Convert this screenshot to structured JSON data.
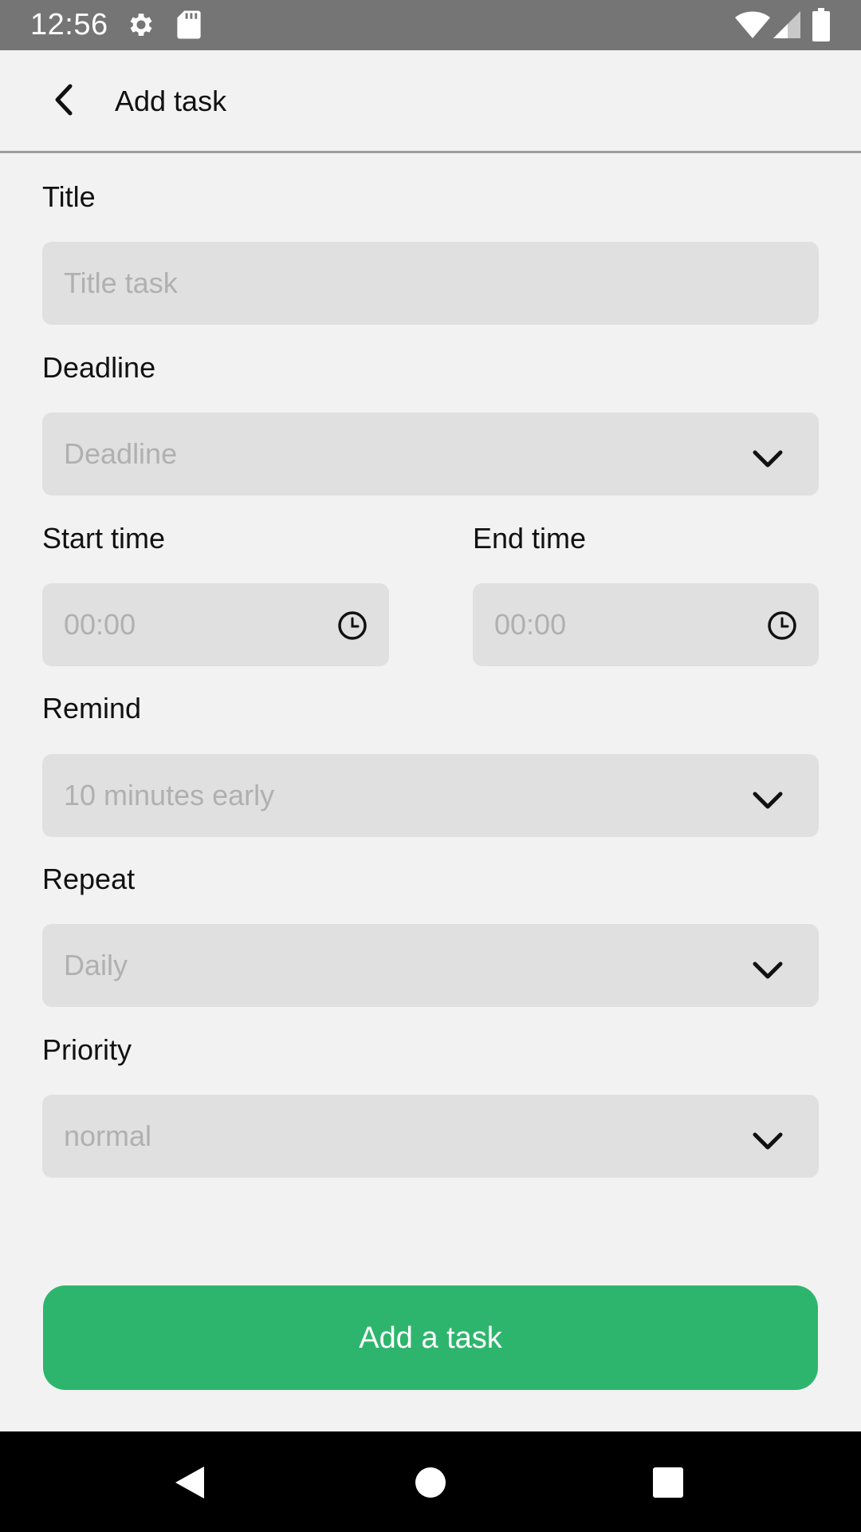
{
  "status_bar": {
    "time": "12:56",
    "icons": [
      "gear-icon",
      "sd-card-icon",
      "wifi-icon",
      "signal-icon",
      "battery-icon"
    ]
  },
  "app_bar": {
    "back_icon": "chevron-left-icon",
    "title": "Add task"
  },
  "form": {
    "title": {
      "label": "Title",
      "placeholder": "Title task"
    },
    "deadline": {
      "label": "Deadline",
      "placeholder": "Deadline"
    },
    "start_time": {
      "label": "Start time",
      "placeholder": "00:00"
    },
    "end_time": {
      "label": "End time",
      "placeholder": "00:00"
    },
    "remind": {
      "label": "Remind",
      "value": "10 minutes early"
    },
    "repeat": {
      "label": "Repeat",
      "value": "Daily"
    },
    "priority": {
      "label": "Priority",
      "value": "normal"
    }
  },
  "primary_button": {
    "label": "Add a task"
  },
  "colors": {
    "accent": "#2eb56d",
    "field_bg": "#e0e0e0",
    "placeholder": "#b0b0b0",
    "status_bar": "#757575",
    "background": "#f2f2f2"
  },
  "nav_bar": {
    "icons": [
      "nav-back-icon",
      "nav-home-icon",
      "nav-recents-icon"
    ]
  }
}
